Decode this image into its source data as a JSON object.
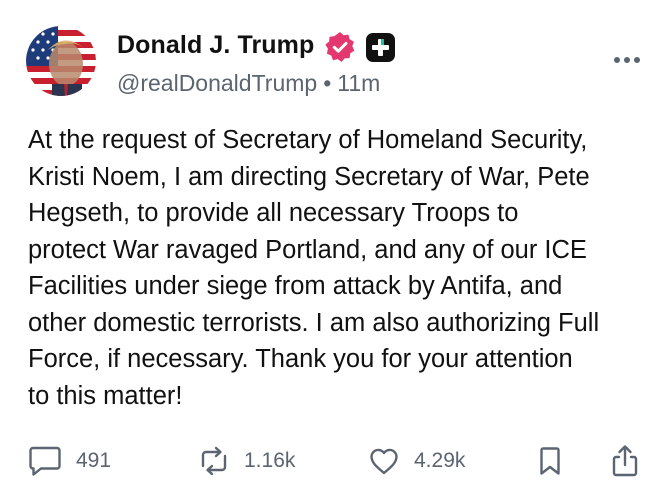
{
  "post": {
    "display_name": "Donald J. Trump",
    "handle": "@realDonaldTrump",
    "separator": "•",
    "time": "11m",
    "text": "At the request of Secretary of Homeland Security,\nKristi Noem, I am directing Secretary of War, Pete\nHegseth, to provide all necessary Troops to\nprotect War ravaged Portland, and any of our ICE\nFacilities under siege from attack by Antifa, and\nother domestic terrorists. I am also authorizing Full\nForce, if necessary. Thank you for your attention\nto this matter!"
  },
  "icons": {
    "verified": "verified-badge-icon",
    "plus_badge": "plus-badge-icon",
    "more": "more-dots-icon",
    "reply": "speech-bubble-icon",
    "retruth": "repost-arrows-icon",
    "like": "heart-icon",
    "bookmark": "bookmark-icon",
    "share": "share-icon"
  },
  "actions": {
    "replies": "491",
    "retruths": "1.16k",
    "likes": "4.29k"
  },
  "colors": {
    "verified": "#e4376f",
    "plus_badge": "#111111",
    "muted_text": "#5b6470",
    "icon_gray": "#5b6470"
  }
}
